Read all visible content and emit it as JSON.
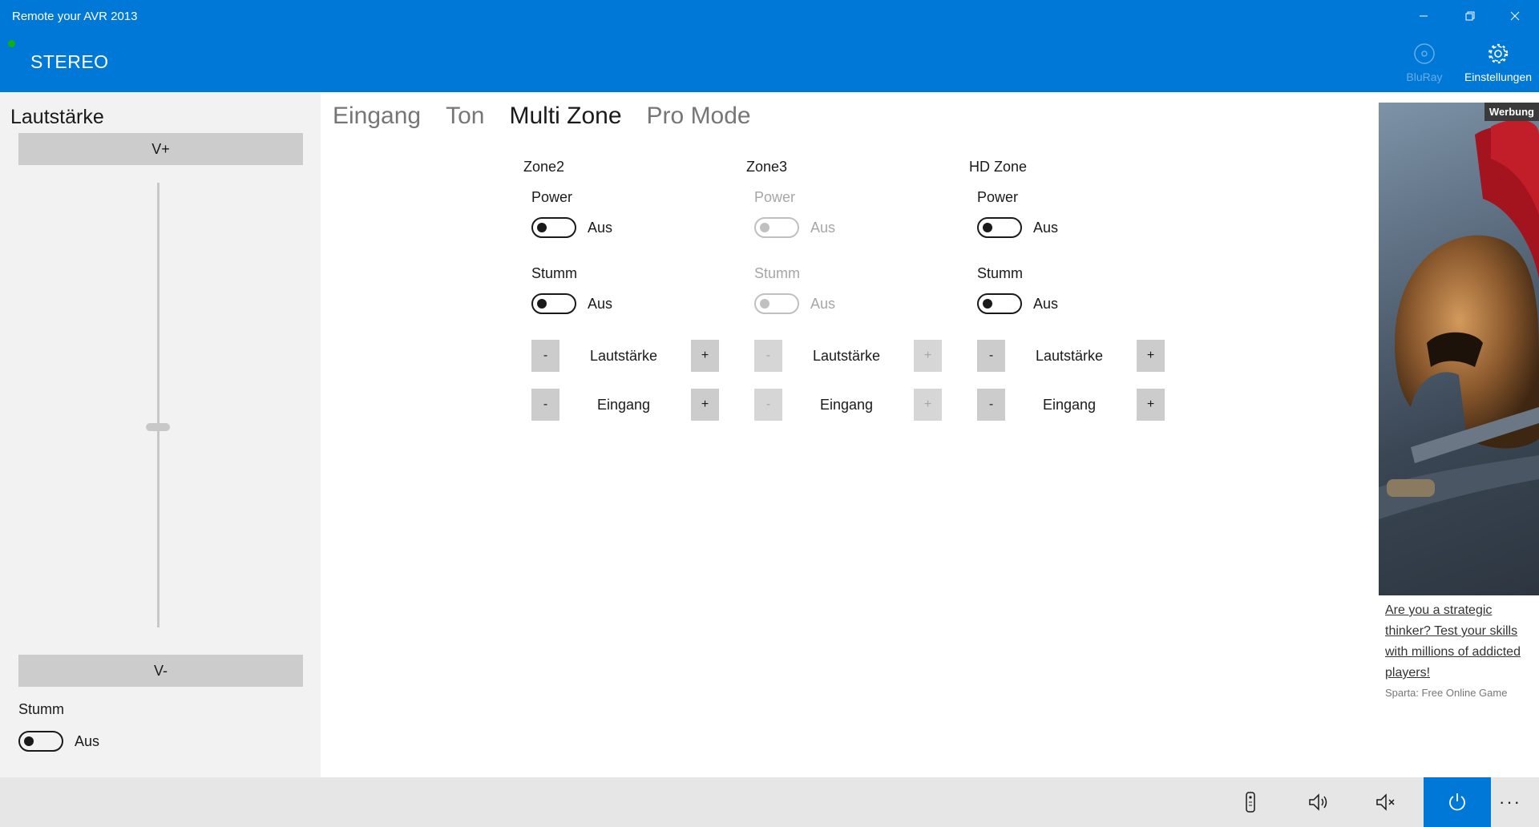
{
  "window": {
    "title": "Remote your AVR 2013"
  },
  "header": {
    "now_playing": "STEREO",
    "status_color": "#10b010",
    "accent": "#0078d7",
    "buttons": [
      {
        "label": "BluRay",
        "icon": "disc-icon",
        "enabled": false
      },
      {
        "label": "Einstellungen",
        "icon": "gear-icon",
        "enabled": true
      }
    ]
  },
  "volume_panel": {
    "title": "Lautstärke",
    "up_label": "V+",
    "down_label": "V-",
    "slider_level": 0.45,
    "mute_label": "Stumm",
    "mute_state": "Aus"
  },
  "tabs": [
    {
      "label": "Eingang",
      "active": false
    },
    {
      "label": "Ton",
      "active": false
    },
    {
      "label": "Multi Zone",
      "active": true
    },
    {
      "label": "Pro Mode",
      "active": false
    }
  ],
  "zones": [
    {
      "title": "Zone2",
      "power_label": "Power",
      "power_state": "Aus",
      "mute_label": "Stumm",
      "mute_state": "Aus",
      "volume_label": "Lautstärke",
      "input_label": "Eingang",
      "minus": "-",
      "plus": "+",
      "enabled": true
    },
    {
      "title": "Zone3",
      "power_label": "Power",
      "power_state": "Aus",
      "mute_label": "Stumm",
      "mute_state": "Aus",
      "volume_label": "Lautstärke",
      "input_label": "Eingang",
      "minus": "-",
      "plus": "+",
      "enabled": false
    },
    {
      "title": "HD Zone",
      "power_label": "Power",
      "power_state": "Aus",
      "mute_label": "Stumm",
      "mute_state": "Aus",
      "volume_label": "Lautstärke",
      "input_label": "Eingang",
      "minus": "-",
      "plus": "+",
      "enabled": true
    }
  ],
  "ad": {
    "badge": "Werbung",
    "headline": "Are you a strategic thinker? Test your skills with millions of addicted players!",
    "source": "Sparta: Free Online Game"
  },
  "bottom_bar": {
    "buttons": [
      "remote-icon",
      "volume-icon",
      "mute-icon",
      "power-icon",
      "more-icon"
    ],
    "more_label": "···"
  }
}
